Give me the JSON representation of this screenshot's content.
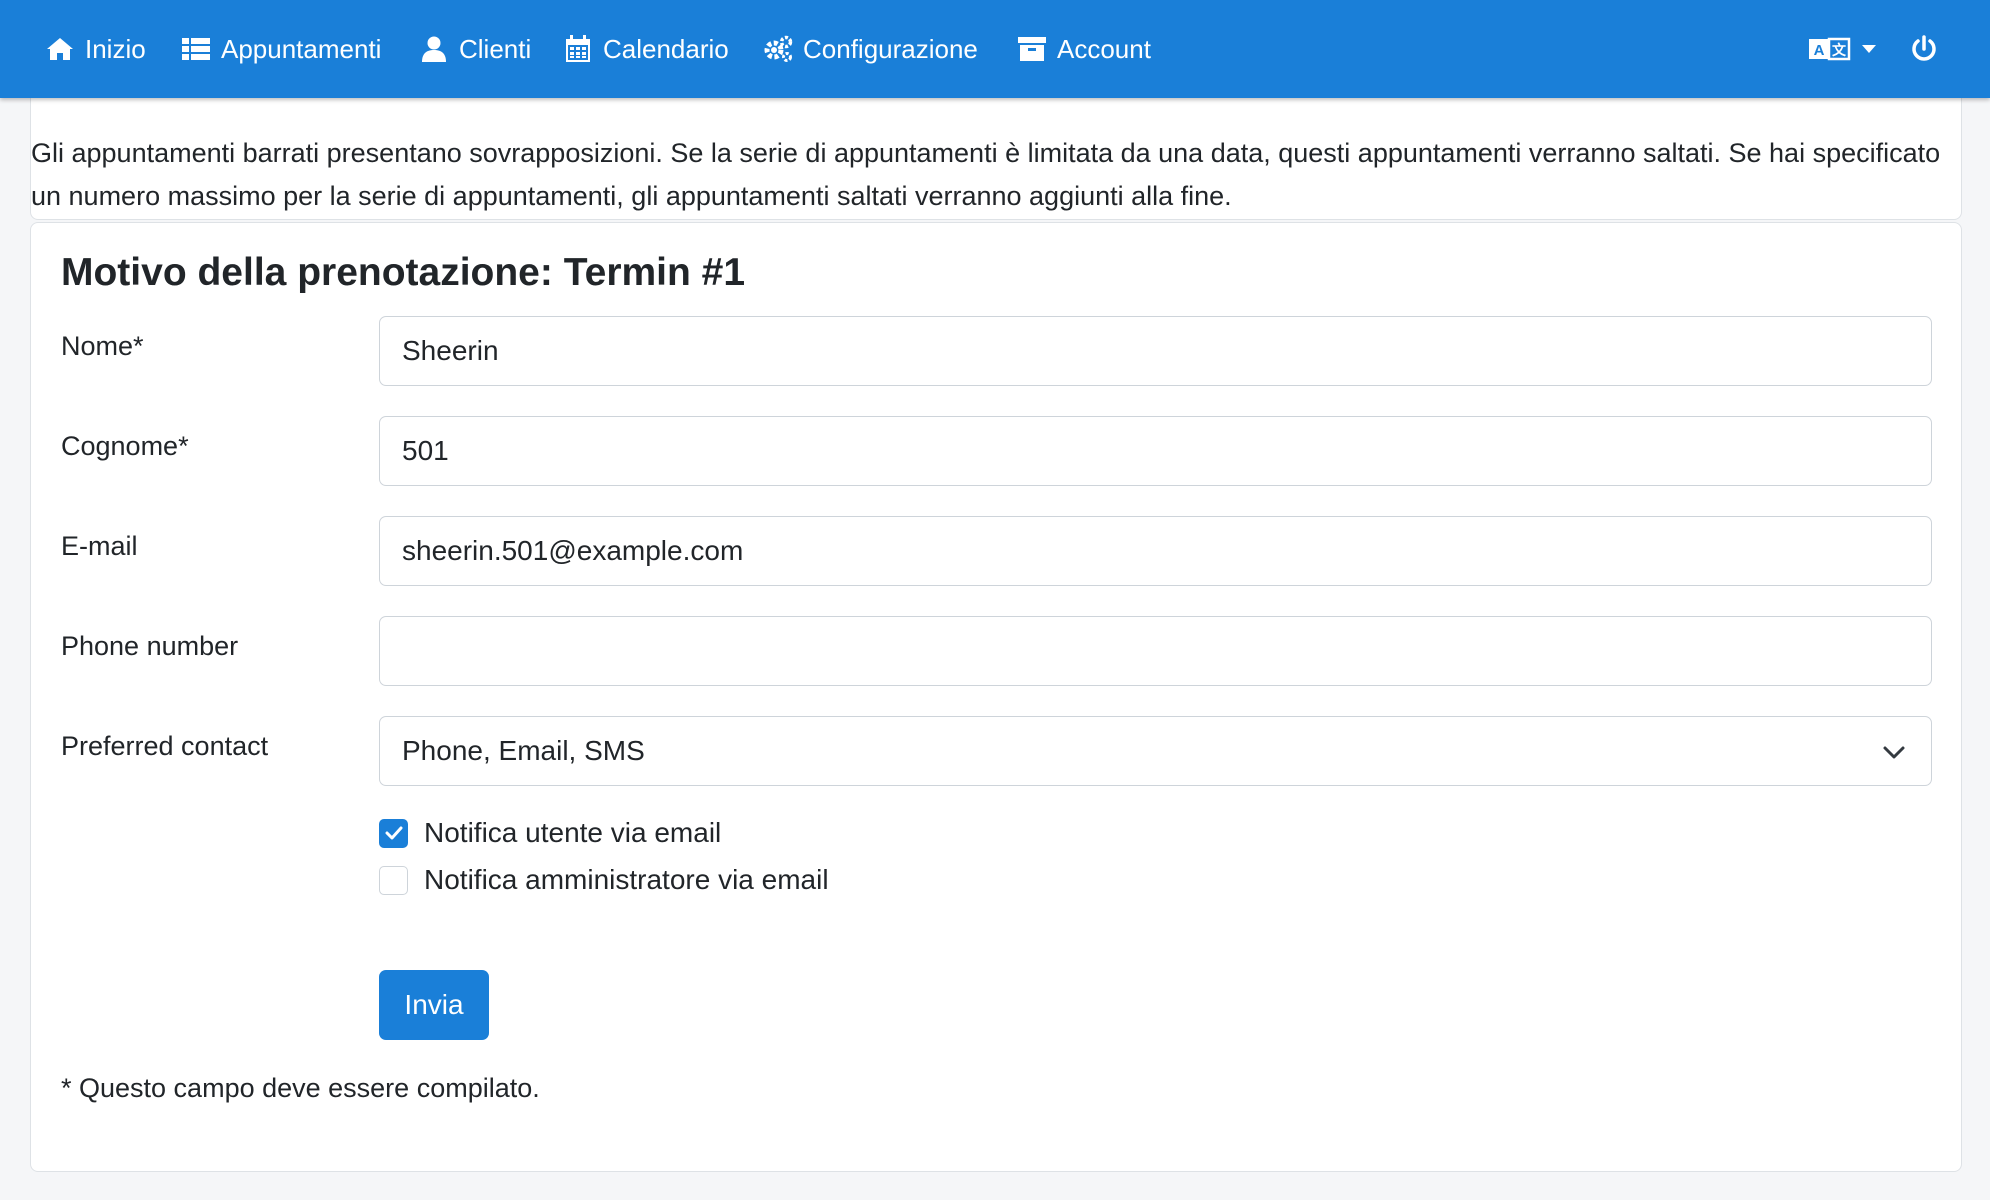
{
  "colors": {
    "primary": "#1a7fd8",
    "page_bg": "#f5f6f8",
    "text": "#212529"
  },
  "nav": {
    "items": [
      {
        "label": "Inizio",
        "icon": "home-icon"
      },
      {
        "label": "Appuntamenti",
        "icon": "list-icon"
      },
      {
        "label": "Clienti",
        "icon": "user-icon"
      },
      {
        "label": "Calendario",
        "icon": "calendar-icon"
      },
      {
        "label": "Configurazione",
        "icon": "gears-icon"
      },
      {
        "label": "Account",
        "icon": "archive-icon"
      }
    ],
    "language_icon": "language-icon",
    "power_icon": "power-icon"
  },
  "info": {
    "text": "Gli appuntamenti barrati presentano sovrapposizioni. Se la serie di appuntamenti è limitata da una data, questi appuntamenti verranno saltati. Se hai specificato un numero massimo per la serie di appuntamenti, gli appuntamenti saltati verranno aggiunti alla fine."
  },
  "form": {
    "title": "Motivo della prenotazione: Termin #1",
    "fields": {
      "first_name": {
        "label": "Nome*",
        "value": "Sheerin"
      },
      "last_name": {
        "label": "Cognome*",
        "value": "501"
      },
      "email": {
        "label": "E-mail",
        "value": "sheerin.501@example.com"
      },
      "phone": {
        "label": "Phone number",
        "value": ""
      },
      "preferred_contact": {
        "label": "Preferred contact",
        "value": "Phone, Email, SMS"
      }
    },
    "checkboxes": {
      "notify_user": {
        "label": "Notifica utente via email",
        "checked": true
      },
      "notify_admin": {
        "label": "Notifica amministratore via email",
        "checked": false
      }
    },
    "submit_label": "Invia",
    "required_note": "* Questo campo deve essere compilato."
  }
}
